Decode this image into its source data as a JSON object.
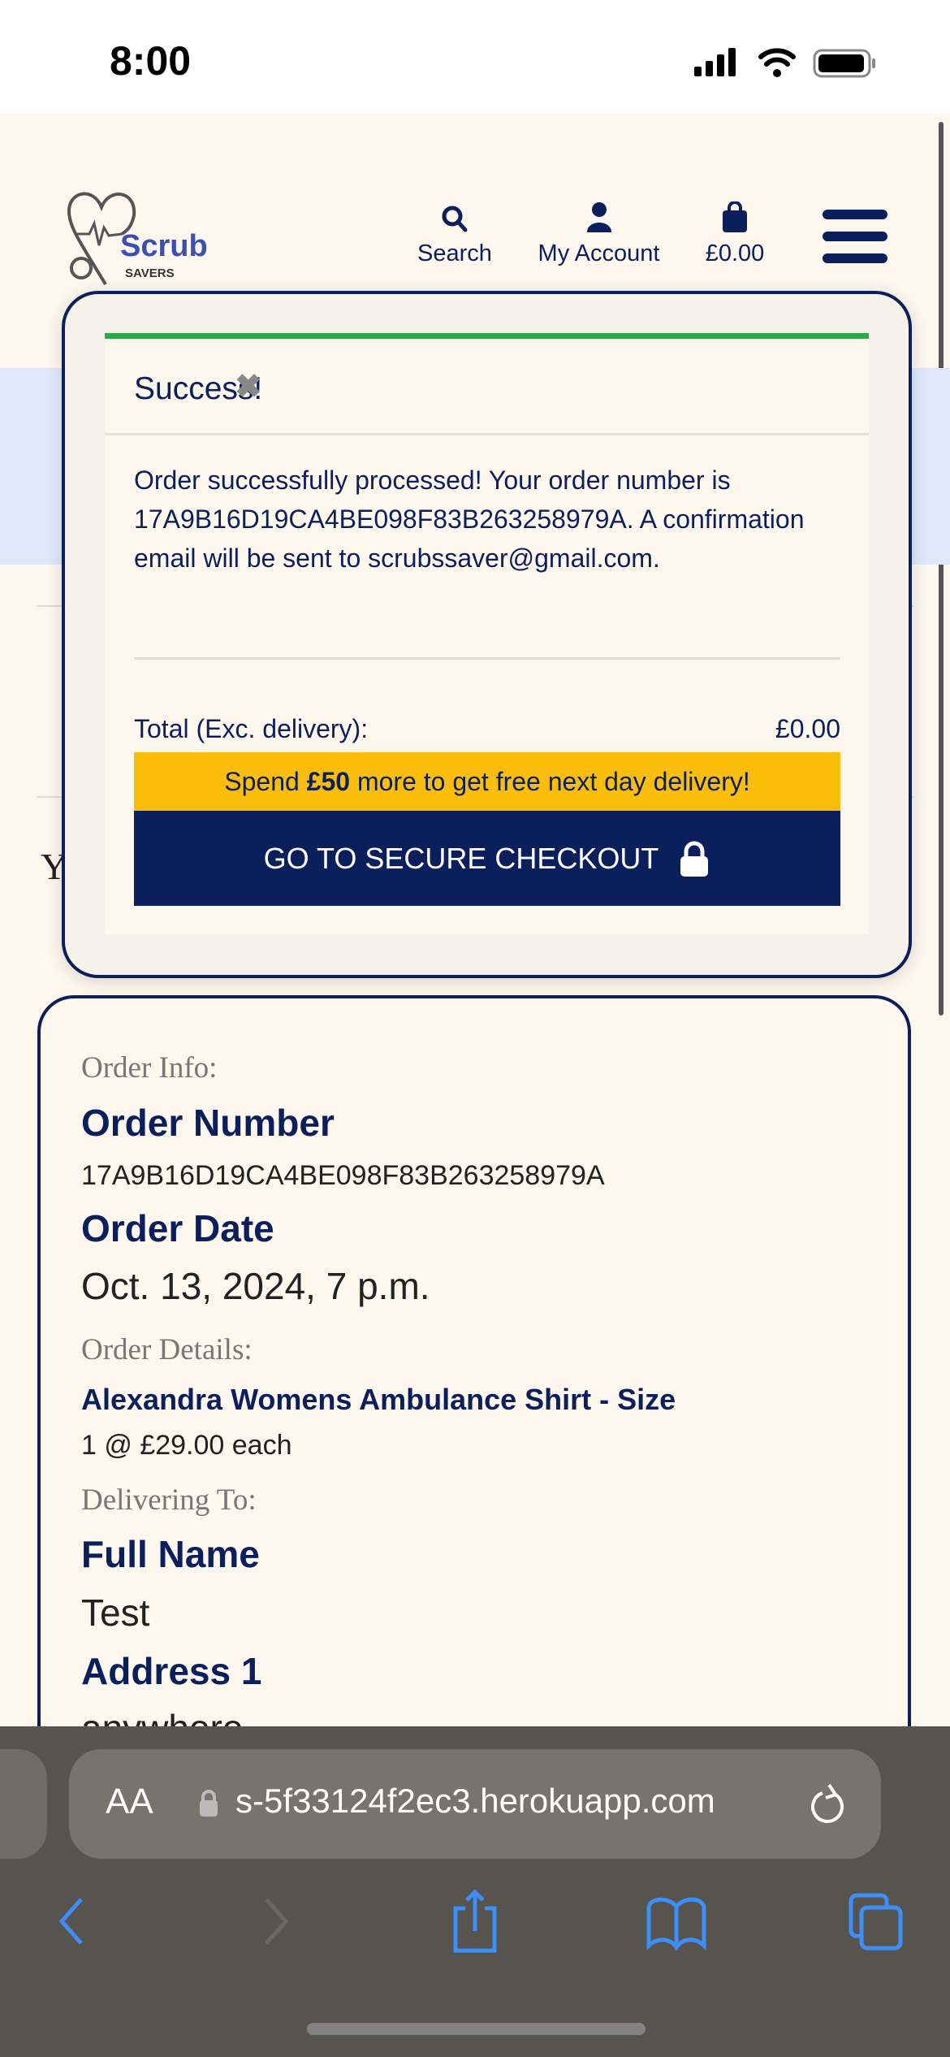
{
  "status": {
    "time": "8:00"
  },
  "header": {
    "logo_text": "Scrub",
    "logo_sub": "SAVERS",
    "search": "Search",
    "account": "My Account",
    "bag_total": "£0.00"
  },
  "page": {
    "partial_text": "Y"
  },
  "toast": {
    "title": "Success!",
    "message": "Order successfully processed! Your order number is 17A9B16D19CA4BE098F83B263258979A. A confirmation email will be sent to scrubssaver@gmail.com.",
    "total_label": "Total (Exc. delivery):",
    "total_value": "£0.00",
    "spend_pre": "Spend ",
    "spend_amount": "£50",
    "spend_post": " more to get free next day delivery!",
    "checkout": "GO TO SECURE CHECKOUT"
  },
  "order": {
    "info_label": "Order Info:",
    "number_label": "Order Number",
    "number": "17A9B16D19CA4BE098F83B263258979A",
    "date_label": "Order Date",
    "date": "Oct. 13, 2024, 7 p.m.",
    "details_label": "Order Details:",
    "product": "Alexandra Womens Ambulance Shirt - Size",
    "qty": "1 @ £29.00 each",
    "delivering_label": "Delivering To:",
    "fullname_label": "Full Name",
    "fullname": "Test",
    "address1_label": "Address 1",
    "address1": "anywhere"
  },
  "browser": {
    "aa": "AA",
    "url": "s-5f33124f2ec3.herokuapp.com"
  },
  "colors": {
    "navy": "#0b1f5c",
    "green": "#2ea84a",
    "yellow": "#f9bd0a"
  }
}
